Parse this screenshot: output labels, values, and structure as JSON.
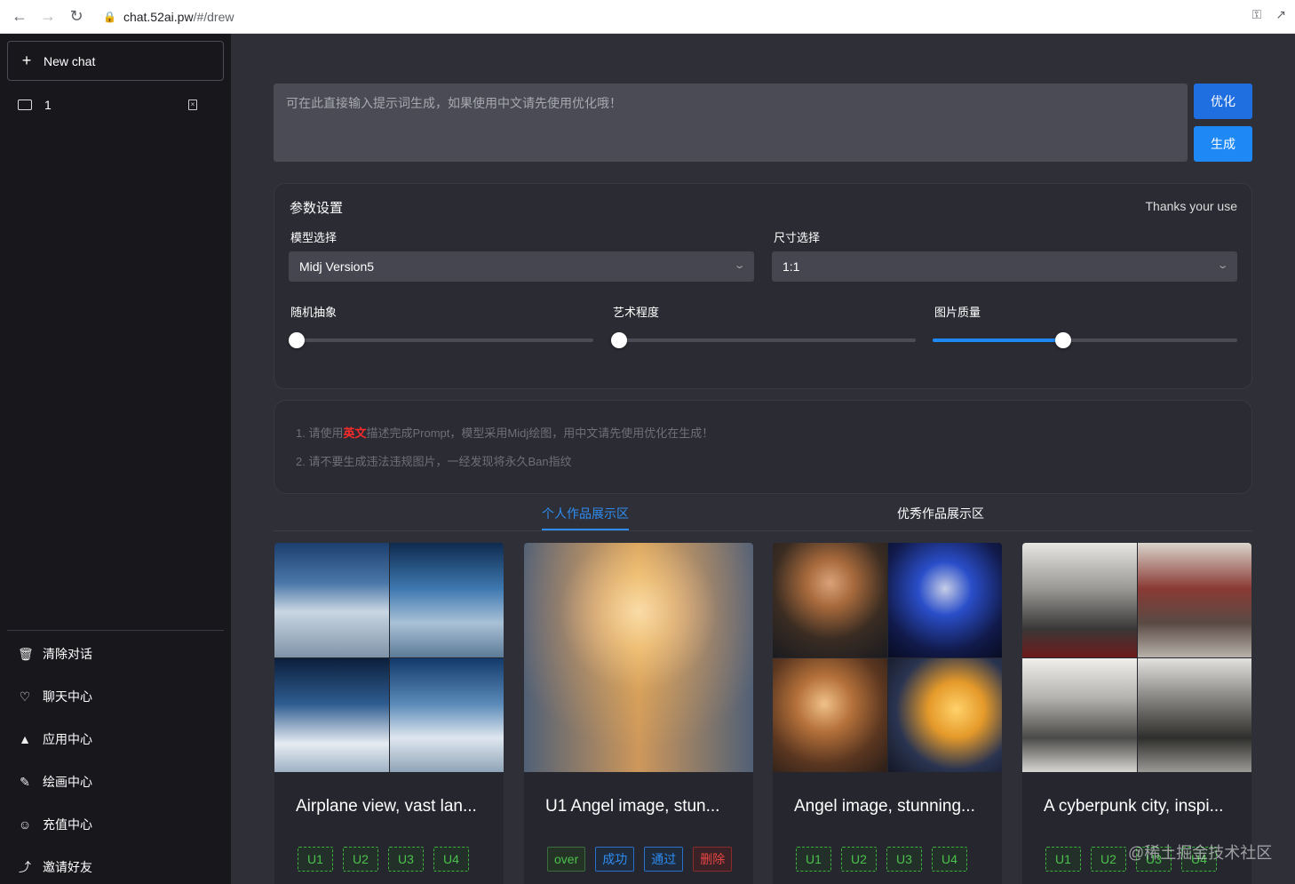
{
  "browser": {
    "url_host": "chat.52ai.pw",
    "url_path": "/#/drew"
  },
  "sidebar": {
    "new_chat_label": "New chat",
    "chats": [
      {
        "title": "1"
      }
    ],
    "menu": [
      {
        "label": "清除对话",
        "icon": "trash-icon"
      },
      {
        "label": "聊天中心",
        "icon": "heart-icon"
      },
      {
        "label": "应用中心",
        "icon": "apps-icon"
      },
      {
        "label": "绘画中心",
        "icon": "brush-icon"
      },
      {
        "label": "充值中心",
        "icon": "user-icon"
      },
      {
        "label": "邀请好友",
        "icon": "share-icon"
      }
    ]
  },
  "prompt": {
    "placeholder": "可在此直接输入提示词生成，如果使用中文请先使用优化哦！",
    "optimize_label": "优化",
    "generate_label": "生成"
  },
  "params": {
    "title": "参数设置",
    "thanks": "Thanks your use",
    "model_label": "模型选择",
    "model_value": "Midj Version5",
    "size_label": "尺寸选择",
    "size_value": "1:1",
    "chaos_label": "随机抽象",
    "chaos_value": 0,
    "art_label": "艺术程度",
    "art_value": 0,
    "quality_label": "图片质量",
    "quality_value": 0.43
  },
  "notes": {
    "line1_prefix": "1. 请使用",
    "line1_highlight": "英文",
    "line1_suffix": "描述完成Prompt，模型采用Midj绘图，用中文请先使用优化在生成！",
    "line2": "2. 请不要生成违法违规图片，一经发现将永久Ban指纹"
  },
  "tabs": {
    "personal": "个人作品展示区",
    "excellent": "优秀作品展示区"
  },
  "cards": [
    {
      "title": "Airplane view, vast lan...",
      "buttons": [
        "U1",
        "U2",
        "U3",
        "U4"
      ]
    },
    {
      "title": "U1 Angel image, stun...",
      "buttons": [
        "over",
        "成功",
        "通过",
        "删除"
      ]
    },
    {
      "title": "Angel image, stunning...",
      "buttons": [
        "U1",
        "U2",
        "U3",
        "U4"
      ]
    },
    {
      "title": "A cyberpunk city, inspi...",
      "buttons": [
        "U1",
        "U2",
        "U3",
        "U4"
      ]
    }
  ],
  "watermark": "@稀土掘金技术社区",
  "colors": {
    "accent": "#1e88f5",
    "sidebar_bg": "#18181c",
    "main_bg": "#2e2f37"
  }
}
